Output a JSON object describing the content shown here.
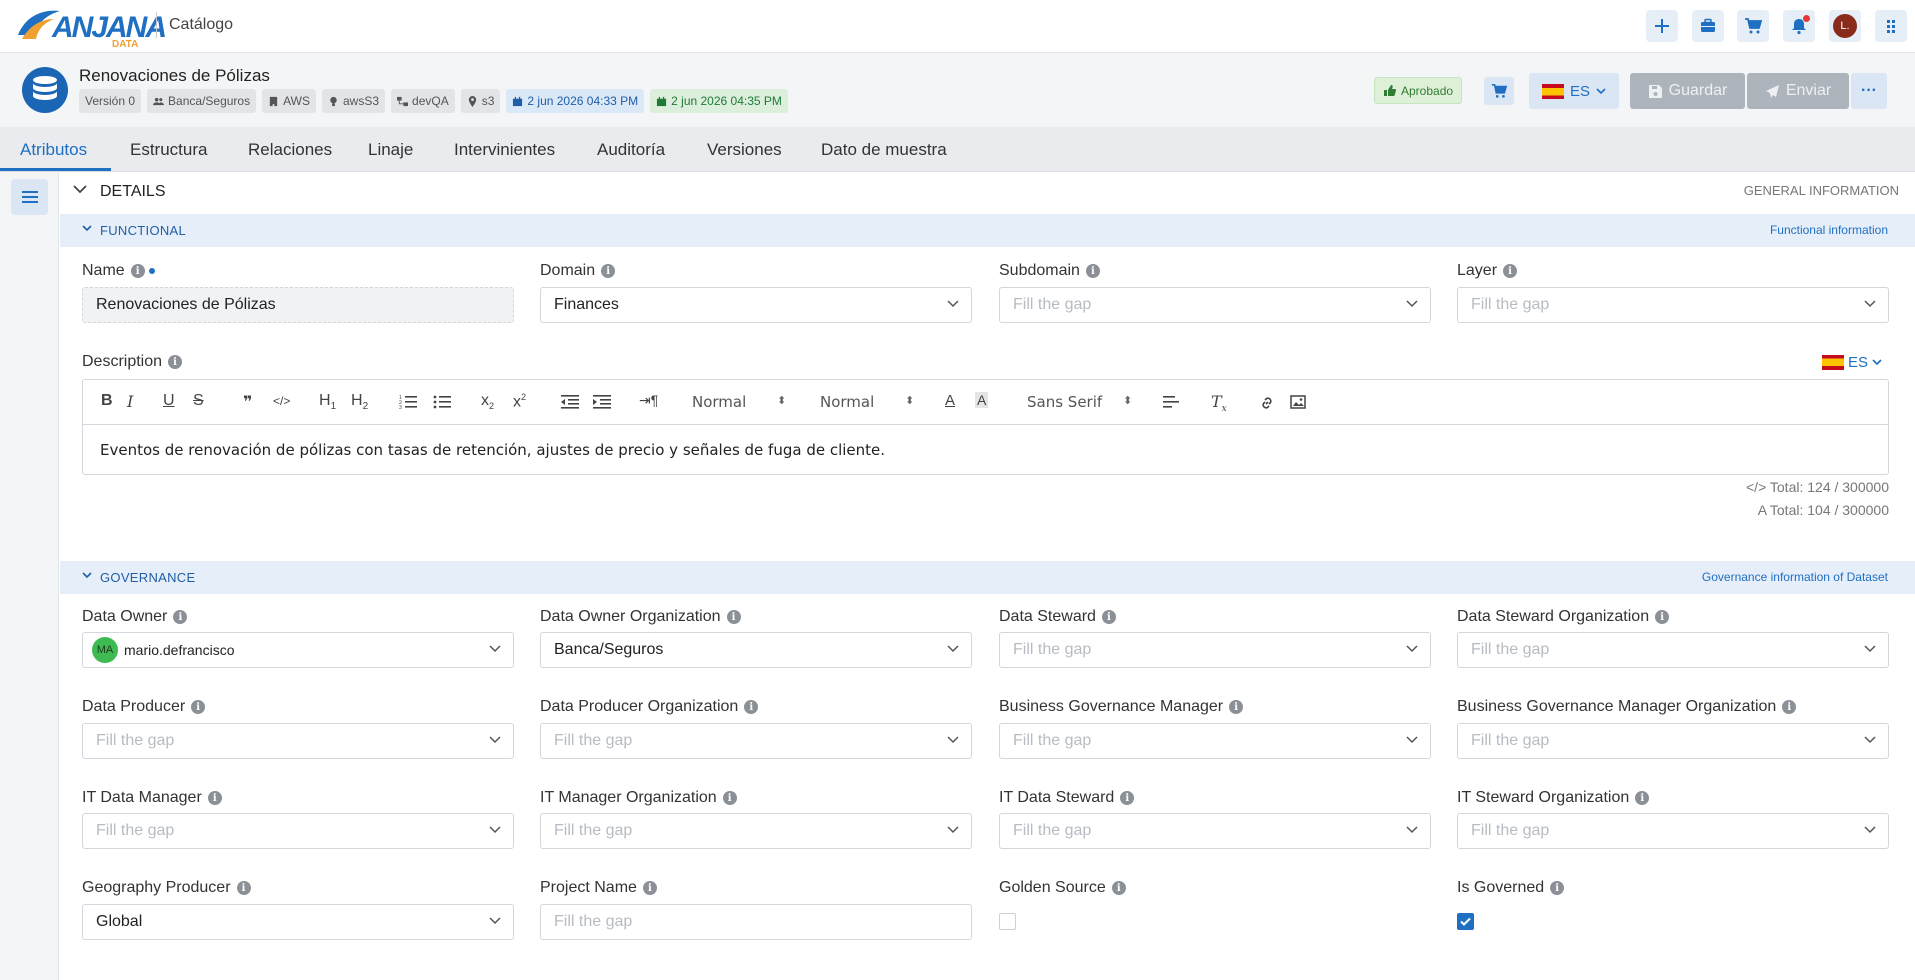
{
  "topbar": {
    "logo_text": "ANJANA",
    "logo_sub": "DATA",
    "app_title": "Catálogo",
    "user_initial": "L."
  },
  "header": {
    "dataset_name": "Renovaciones de Pólizas",
    "tags": [
      {
        "label": "Versión 0",
        "icon": "none",
        "style": "gray"
      },
      {
        "label": "Banca/Seguros",
        "icon": "users-icon",
        "style": "gray"
      },
      {
        "label": "AWS",
        "icon": "building-icon",
        "style": "gray"
      },
      {
        "label": "awsS3",
        "icon": "bulb-icon",
        "style": "gray"
      },
      {
        "label": "devQA",
        "icon": "network-icon",
        "style": "gray"
      },
      {
        "label": "s3",
        "icon": "pin-icon",
        "style": "gray"
      },
      {
        "label": "2 jun 2026 04:33 PM",
        "icon": "calendar-icon",
        "style": "blue"
      },
      {
        "label": "2 jun 2026 04:35 PM",
        "icon": "calendar-check-icon",
        "style": "green"
      }
    ],
    "status": "Aprobado",
    "lang": "ES",
    "save_label": "Guardar",
    "send_label": "Enviar",
    "more_label": "···"
  },
  "tabs": [
    "Atributos",
    "Estructura",
    "Relaciones",
    "Linaje",
    "Intervinientes",
    "Auditoría",
    "Versiones",
    "Dato de muestra"
  ],
  "details": {
    "title": "DETAILS",
    "right_label": "GENERAL INFORMATION"
  },
  "functional": {
    "title": "FUNCTIONAL",
    "right_label": "Functional information",
    "name_label": "Name",
    "name_value": "Renovaciones de Pólizas",
    "domain_label": "Domain",
    "domain_value": "Finances",
    "subdomain_label": "Subdomain",
    "subdomain_placeholder": "Fill the gap",
    "layer_label": "Layer",
    "layer_placeholder": "Fill the gap",
    "description_label": "Description",
    "description_lang": "ES",
    "toolbar": {
      "header_select": "Normal",
      "size_select": "Normal",
      "font_select": "Sans Serif"
    },
    "description_text": "Eventos de renovación de pólizas con tasas de retención, ajustes de precio y señales de fuga de cliente.",
    "counter_html": "Total: 124 / 300000",
    "counter_text": "Total: 104 / 300000"
  },
  "governance": {
    "title": "GOVERNANCE",
    "right_label": "Governance information of Dataset",
    "placeholder": "Fill the gap",
    "data_owner_label": "Data Owner",
    "data_owner_initials": "MA",
    "data_owner_value": "mario.defrancisco",
    "data_owner_org_label": "Data Owner Organization",
    "data_owner_org_value": "Banca/Seguros",
    "data_steward_label": "Data Steward",
    "data_steward_org_label": "Data Steward Organization",
    "data_producer_label": "Data Producer",
    "data_producer_org_label": "Data Producer Organization",
    "bgm_label": "Business Governance Manager",
    "bgm_org_label": "Business Governance Manager Organization",
    "it_data_manager_label": "IT Data Manager",
    "it_manager_org_label": "IT Manager Organization",
    "it_data_steward_label": "IT Data Steward",
    "it_steward_org_label": "IT Steward Organization",
    "geography_label": "Geography Producer",
    "geography_value": "Global",
    "project_label": "Project Name",
    "golden_label": "Golden Source",
    "golden_checked": false,
    "governed_label": "Is Governed",
    "governed_checked": true
  },
  "colors": {
    "accent": "#1f6fc2",
    "approved_bg": "#dff0d8",
    "section_bg": "#e6eff9"
  }
}
